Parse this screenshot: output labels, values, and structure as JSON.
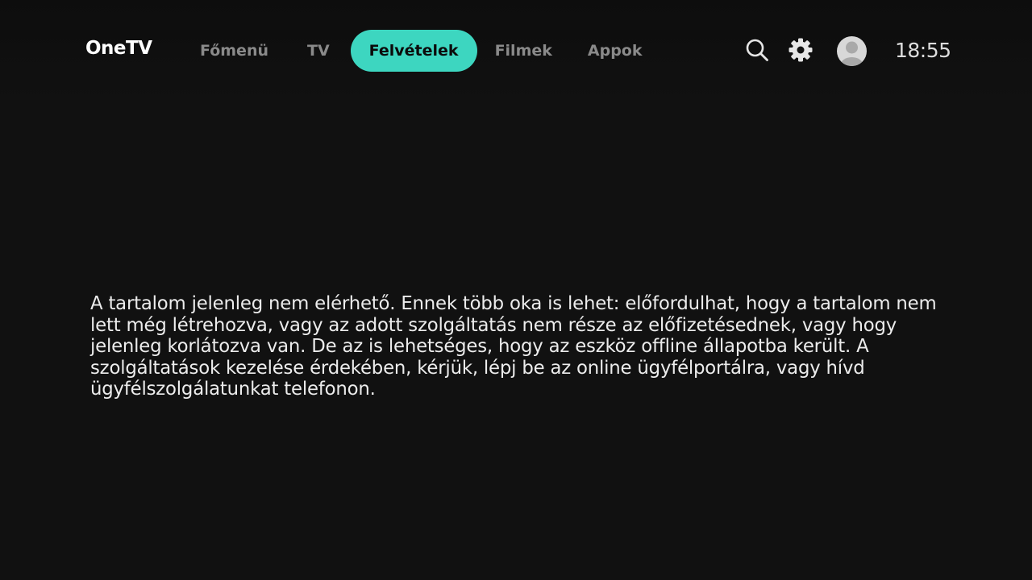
{
  "header": {
    "logo": "OneTV",
    "nav": [
      {
        "label": "Főmenü",
        "active": false
      },
      {
        "label": "TV",
        "active": false
      },
      {
        "label": "Felvételek",
        "active": true
      },
      {
        "label": "Filmek",
        "active": false
      },
      {
        "label": "Appok",
        "active": false
      }
    ],
    "icons": {
      "search": "search-icon",
      "settings": "gear-icon",
      "profile": "user-avatar-icon"
    },
    "clock": "18:55"
  },
  "main": {
    "message": "A tartalom jelenleg nem elérhető. Ennek több oka is lehet: előfordulhat, hogy a tartalom nem lett még létrehozva, vagy az adott szolgáltatás nem része az előfizetésednek, vagy hogy jelenleg korlátozva van. De az is lehetséges, hogy az eszköz offline állapotba került. A szolgáltatások kezelése érdekében, kérjük, lépj be az online ügyfélportálra, vagy hívd ügyfélszolgálatunkat telefonon."
  },
  "colors": {
    "background": "#111111",
    "accent": "#3dd6c0",
    "nav_inactive": "#8a8a8a",
    "text": "#ececec"
  }
}
